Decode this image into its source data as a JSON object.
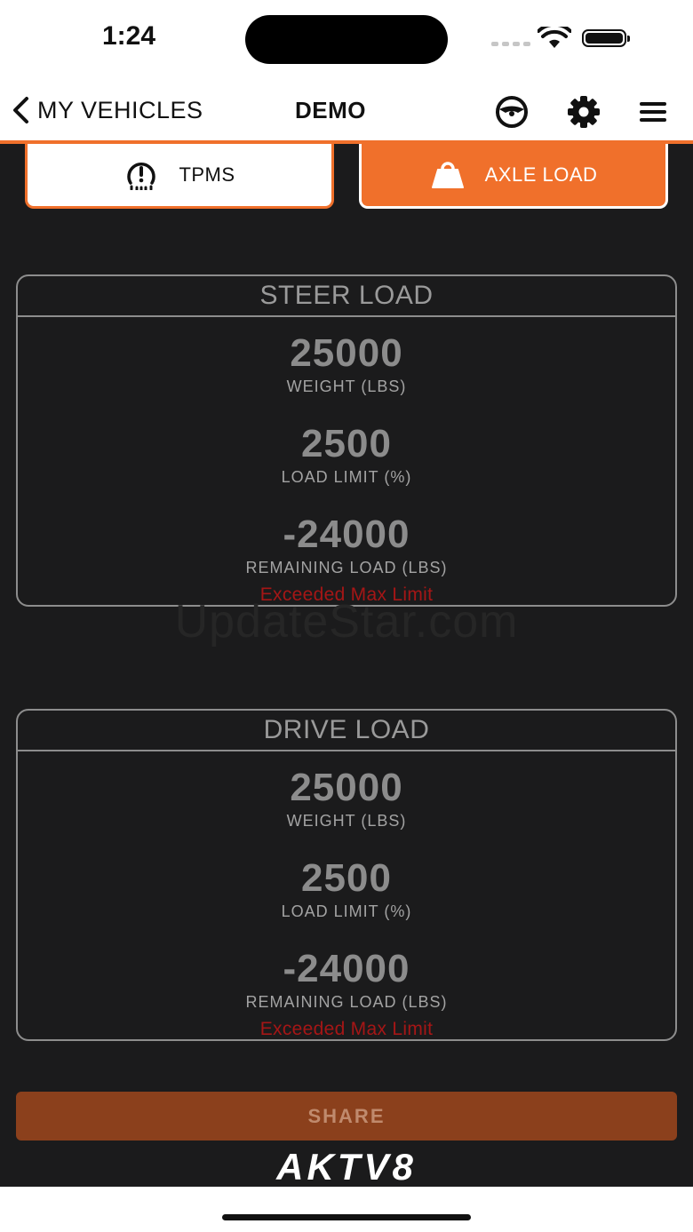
{
  "status_bar": {
    "time": "1:24"
  },
  "nav": {
    "back_label": "MY VEHICLES",
    "title": "DEMO"
  },
  "tabs": [
    {
      "label": "TPMS",
      "icon": "tire-pressure-warning-icon",
      "selected": false
    },
    {
      "label": "AXLE LOAD",
      "icon": "weight-icon",
      "selected": true
    }
  ],
  "watermark": "UpdateStar.com",
  "cards": [
    {
      "title": "STEER LOAD",
      "metrics": [
        {
          "value": "25000",
          "label": "WEIGHT (LBS)"
        },
        {
          "value": "2500",
          "label": "LOAD LIMIT (%)"
        },
        {
          "value": "-24000",
          "label": "REMAINING LOAD (LBS)"
        }
      ],
      "warning": "Exceeded Max Limit"
    },
    {
      "title": "DRIVE LOAD",
      "metrics": [
        {
          "value": "25000",
          "label": "WEIGHT (LBS)"
        },
        {
          "value": "2500",
          "label": "LOAD LIMIT (%)"
        },
        {
          "value": "-24000",
          "label": "REMAINING LOAD (LBS)"
        }
      ],
      "warning": "Exceeded Max Limit"
    }
  ],
  "share_label": "SHARE",
  "logo": "AKTV8",
  "colors": {
    "accent": "#f0702b",
    "background": "#1b1b1c",
    "warning": "#a51616",
    "share": "#8b401c"
  }
}
